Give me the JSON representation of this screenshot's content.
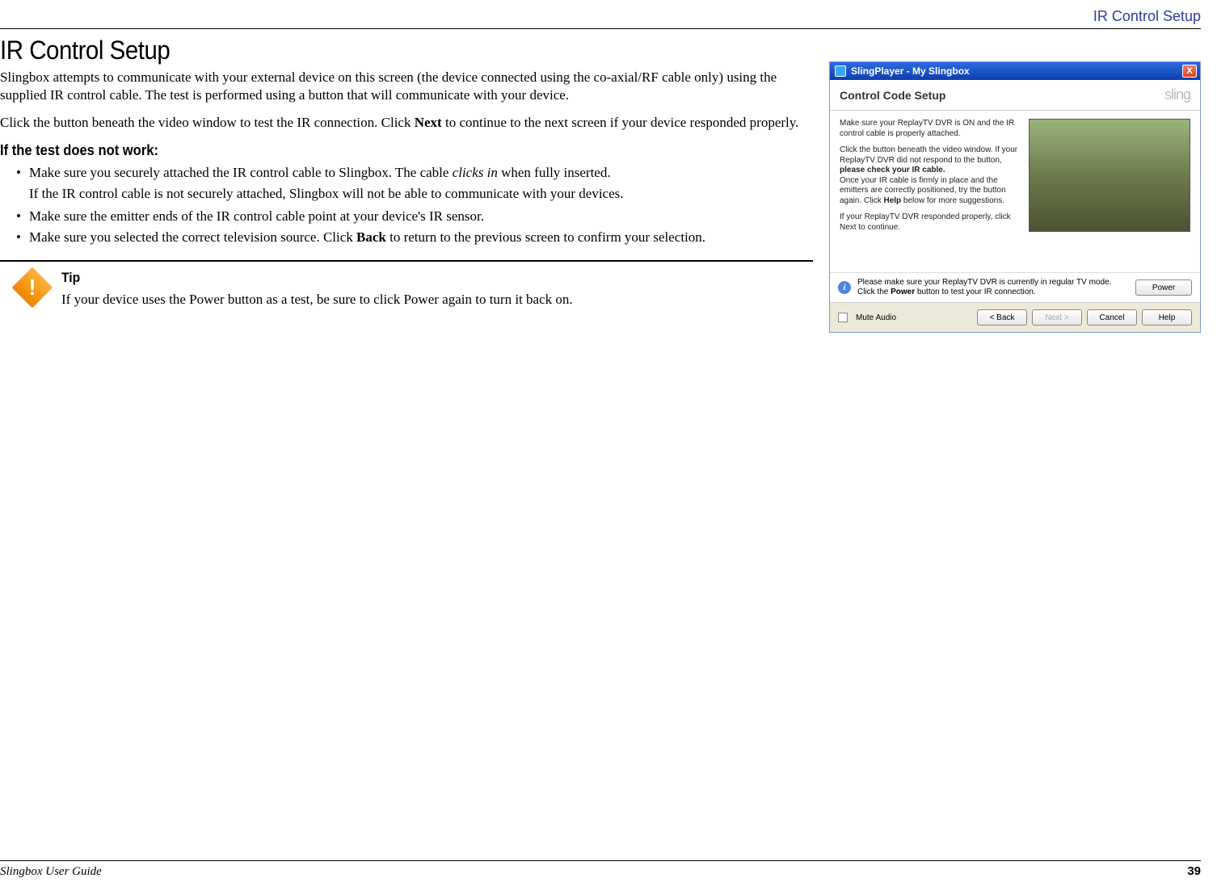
{
  "header": {
    "section": "IR Control Setup"
  },
  "page": {
    "heading": "IR Control Setup",
    "para1": "Slingbox attempts to communicate with your external device on this screen (the device connected using the co-axial/RF cable only) using the supplied IR control cable. The test is performed using a button that will communicate with your device.",
    "para2_a": "Click the button beneath the video window to test the IR connection. Click ",
    "para2_b": "Next",
    "para2_c": " to continue to the next screen if your device responded properly.",
    "sub": "If the test does not work:",
    "li1_a": "Make sure you securely attached the IR control cable to Slingbox. The cable ",
    "li1_b": "clicks in",
    "li1_c": " when fully inserted.",
    "li1_follow": "If the IR control cable is not securely attached, Slingbox will not be able to communicate with your devices.",
    "li2": "Make sure the emitter ends of the IR control cable point at your device's IR sensor.",
    "li3_a": "Make sure you selected the correct television source. Click ",
    "li3_b": "Back",
    "li3_c": " to return to the previous screen to confirm your selection.",
    "tip_title": "Tip",
    "tip_body": "If your device uses the Power button as a test, be sure to click Power again to turn it back on."
  },
  "screenshot": {
    "title": "SlingPlayer - My Slingbox",
    "close": "X",
    "pane_title": "Control Code Setup",
    "logo": "sling",
    "instr1": "Make sure your ReplayTV DVR is ON and the IR control cable is properly attached.",
    "instr2_a": "Click the button beneath the video window. If your ReplayTV DVR did not respond to the button, ",
    "instr2_b": "please check your IR cable.",
    "instr2_c": " Once your IR cable is firmly in place and the emitters are correctly positioned, try the button again. Click ",
    "instr2_d": "Help",
    "instr2_e": " below for more suggestions.",
    "instr3": "If your ReplayTV DVR responded properly, click Next to continue.",
    "info_a": "Please make sure your ReplayTV DVR is currently in regular TV mode.",
    "info_b_a": "Click the ",
    "info_b_b": "Power",
    "info_b_c": " button to test your IR connection.",
    "power_btn": "Power",
    "mute": "Mute Audio",
    "back": "< Back",
    "next": "Next >",
    "cancel": "Cancel",
    "help": "Help"
  },
  "footer": {
    "guide": "Slingbox User Guide",
    "page": "39"
  }
}
